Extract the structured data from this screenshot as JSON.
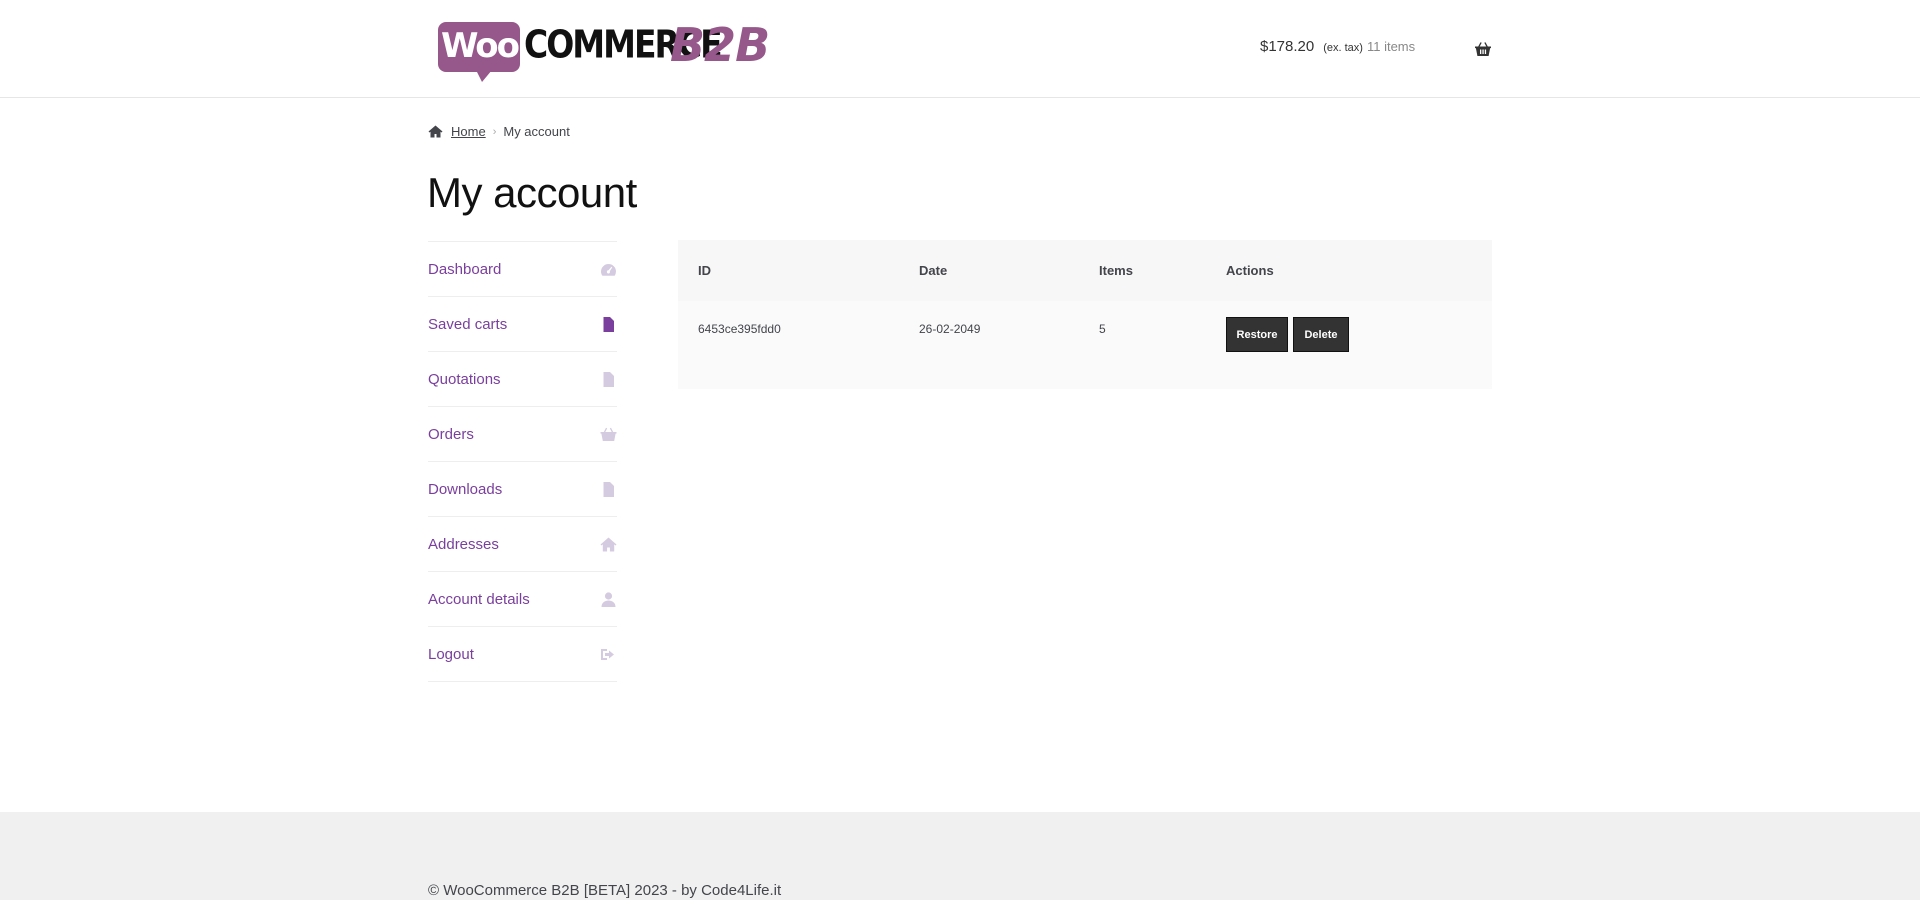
{
  "header": {
    "logo": {
      "part1": "Woo",
      "part2": "COMMERCE",
      "part3": "B2B"
    },
    "cart": {
      "amount": "$178.20",
      "tax_note": "(ex. tax)",
      "item_count": "11 items",
      "icon": "basket-icon"
    }
  },
  "breadcrumb": {
    "home": "Home",
    "separator": "›",
    "current": "My account",
    "icon": "home-icon"
  },
  "page": {
    "title": "My account"
  },
  "nav": {
    "items": [
      {
        "label": "Dashboard",
        "icon": "dashboard-icon",
        "active": false
      },
      {
        "label": "Saved carts",
        "icon": "file-icon",
        "active": true
      },
      {
        "label": "Quotations",
        "icon": "file-text-icon",
        "active": false
      },
      {
        "label": "Orders",
        "icon": "basket-icon",
        "active": false
      },
      {
        "label": "Downloads",
        "icon": "file-download-icon",
        "active": false
      },
      {
        "label": "Addresses",
        "icon": "home-icon",
        "active": false
      },
      {
        "label": "Account details",
        "icon": "user-icon",
        "active": false
      },
      {
        "label": "Logout",
        "icon": "sign-out-icon",
        "active": false
      }
    ]
  },
  "table": {
    "headers": {
      "id": "ID",
      "date": "Date",
      "items": "Items",
      "actions": "Actions"
    },
    "rows": [
      {
        "id": "6453ce395fdd0",
        "date": "26-02-2049",
        "items": "5",
        "restore_label": "Restore",
        "delete_label": "Delete"
      }
    ]
  },
  "footer": {
    "text": "© WooCommerce B2B [BETA] 2023 - by Code4Life.it"
  },
  "colors": {
    "accent": "#7a3f9d",
    "brand": "#96588a",
    "button": "#333333",
    "icon_muted": "#d5cbe0"
  }
}
